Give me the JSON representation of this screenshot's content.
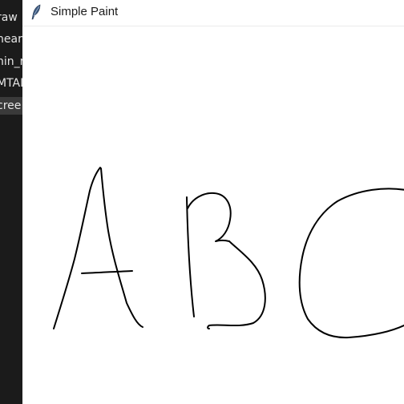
{
  "window": {
    "title": "Simple Paint",
    "icon": "feather-icon"
  },
  "background_window": {
    "sidebar_items": [
      {
        "label": "raw"
      },
      {
        "label": "near"
      },
      {
        "label": "nin_r"
      },
      {
        "label": "MTAD"
      },
      {
        "label": "cree",
        "selected": true
      }
    ]
  },
  "canvas": {
    "background": "#ffffff",
    "stroke_color": "#000000",
    "drawn_text": "ABC"
  }
}
